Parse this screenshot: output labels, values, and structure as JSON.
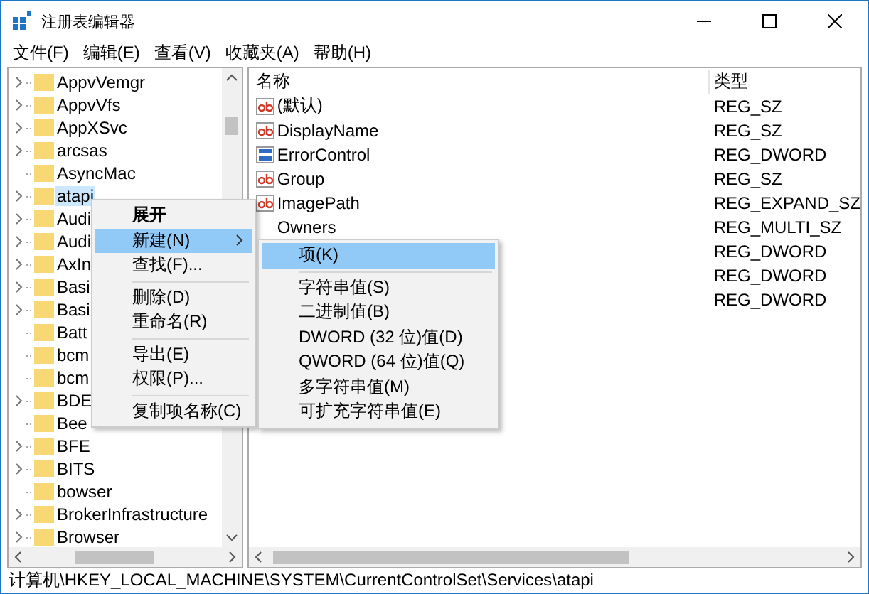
{
  "window": {
    "title": "注册表编辑器"
  },
  "menu_bar": [
    "文件(F)",
    "编辑(E)",
    "查看(V)",
    "收藏夹(A)",
    "帮助(H)"
  ],
  "tree": {
    "items": [
      {
        "label": "AppvVemgr",
        "expandable": true,
        "selected": false
      },
      {
        "label": "AppvVfs",
        "expandable": true,
        "selected": false
      },
      {
        "label": "AppXSvc",
        "expandable": true,
        "selected": false
      },
      {
        "label": "arcsas",
        "expandable": true,
        "selected": false
      },
      {
        "label": "AsyncMac",
        "expandable": false,
        "selected": false
      },
      {
        "label": "atapi",
        "expandable": true,
        "selected": true
      },
      {
        "label": "Audi",
        "expandable": true,
        "selected": false
      },
      {
        "label": "Audi",
        "expandable": true,
        "selected": false
      },
      {
        "label": "AxIn",
        "expandable": true,
        "selected": false
      },
      {
        "label": "Basi",
        "expandable": true,
        "selected": false
      },
      {
        "label": "Basi",
        "expandable": true,
        "selected": false
      },
      {
        "label": "Batt",
        "expandable": false,
        "selected": false
      },
      {
        "label": "bcm",
        "expandable": false,
        "selected": false
      },
      {
        "label": "bcm",
        "expandable": false,
        "selected": false
      },
      {
        "label": "BDE",
        "expandable": true,
        "selected": false
      },
      {
        "label": "Bee",
        "expandable": false,
        "selected": false
      },
      {
        "label": "BFE",
        "expandable": true,
        "selected": false
      },
      {
        "label": "BITS",
        "expandable": true,
        "selected": false
      },
      {
        "label": "bowser",
        "expandable": false,
        "selected": false
      },
      {
        "label": "BrokerInfrastructure",
        "expandable": true,
        "selected": false
      },
      {
        "label": "Browser",
        "expandable": true,
        "selected": false
      }
    ]
  },
  "values": {
    "columns": [
      "名称",
      "类型"
    ],
    "rows": [
      {
        "kind": "string",
        "name": "(默认)",
        "type": "REG_SZ"
      },
      {
        "kind": "string",
        "name": "DisplayName",
        "type": "REG_SZ"
      },
      {
        "kind": "binary",
        "name": "ErrorControl",
        "type": "REG_DWORD"
      },
      {
        "kind": "string",
        "name": "Group",
        "type": "REG_SZ"
      },
      {
        "kind": "string",
        "name": "ImagePath",
        "type": "REG_EXPAND_SZ"
      },
      {
        "kind": "hidden",
        "name": "Owners",
        "type": "REG_MULTI_SZ"
      },
      {
        "kind": "hidden",
        "type": "REG_DWORD"
      },
      {
        "kind": "hidden",
        "type": "REG_DWORD"
      },
      {
        "kind": "hidden",
        "type": "REG_DWORD"
      }
    ]
  },
  "context_menu": {
    "items": [
      {
        "kind": "item",
        "label": "展开",
        "default": true,
        "selected": false,
        "submenu": false
      },
      {
        "kind": "item",
        "label": "新建(N)",
        "default": false,
        "selected": true,
        "submenu": true
      },
      {
        "kind": "item",
        "label": "查找(F)...",
        "default": false,
        "selected": false,
        "submenu": false
      },
      {
        "kind": "separator"
      },
      {
        "kind": "item",
        "label": "删除(D)",
        "default": false,
        "selected": false,
        "submenu": false
      },
      {
        "kind": "item",
        "label": "重命名(R)",
        "default": false,
        "selected": false,
        "submenu": false
      },
      {
        "kind": "separator"
      },
      {
        "kind": "item",
        "label": "导出(E)",
        "default": false,
        "selected": false,
        "submenu": false
      },
      {
        "kind": "item",
        "label": "权限(P)...",
        "default": false,
        "selected": false,
        "submenu": false
      },
      {
        "kind": "separator"
      },
      {
        "kind": "item",
        "label": "复制项名称(C)",
        "default": false,
        "selected": false,
        "submenu": false
      }
    ]
  },
  "submenu": {
    "items": [
      {
        "kind": "item",
        "label": "项(K)",
        "selected": true
      },
      {
        "kind": "separator"
      },
      {
        "kind": "item",
        "label": "字符串值(S)",
        "selected": false
      },
      {
        "kind": "item",
        "label": "二进制值(B)",
        "selected": false
      },
      {
        "kind": "item",
        "label": "DWORD (32 位)值(D)",
        "selected": false
      },
      {
        "kind": "item",
        "label": "QWORD (64 位)值(Q)",
        "selected": false
      },
      {
        "kind": "item",
        "label": "多字符串值(M)",
        "selected": false
      },
      {
        "kind": "item",
        "label": "可扩充字符串值(E)",
        "selected": false
      }
    ]
  },
  "status_bar": "计算机\\HKEY_LOCAL_MACHINE\\SYSTEM\\CurrentControlSet\\Services\\atapi"
}
